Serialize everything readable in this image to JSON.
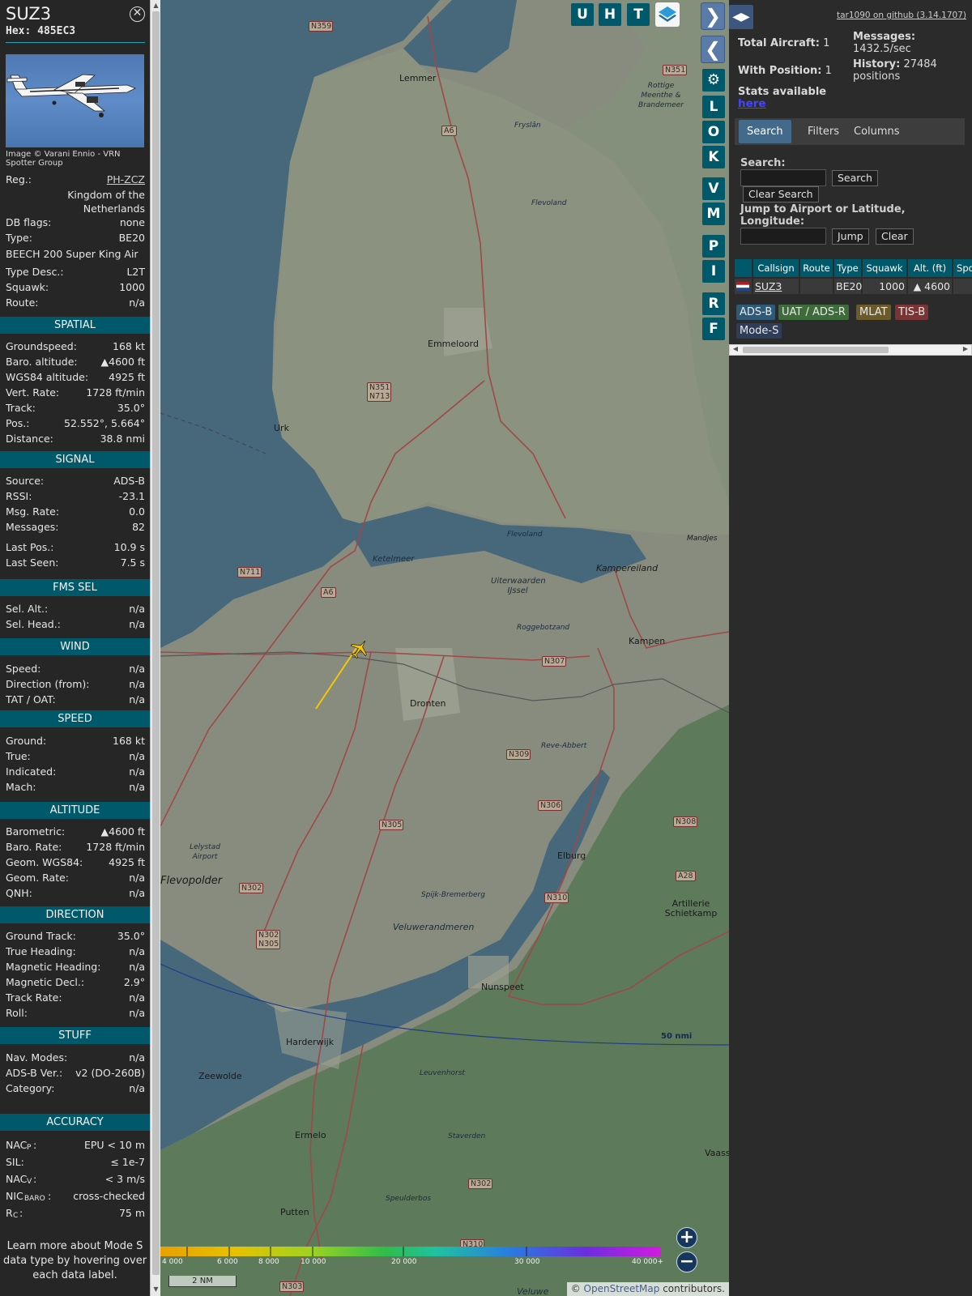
{
  "aircraft": {
    "callsign": "SUZ3",
    "hex_label": "Hex:",
    "hex": "485EC3",
    "photo_credit": "Image © Varani Ennio - VRN Spotter Group",
    "reg_label": "Reg.:",
    "reg": "PH-ZCZ",
    "country": "Kingdom of the Netherlands",
    "rows_top": [
      {
        "k": "DB flags:",
        "v": "none"
      },
      {
        "k": "Type:",
        "v": "BE20"
      }
    ],
    "type_full": "BEECH 200 Super King Air",
    "rows_top2": [
      {
        "k": "Type Desc.:",
        "v": "L2T"
      },
      {
        "k": "Squawk:",
        "v": "1000"
      },
      {
        "k": "Route:",
        "v": "n/a"
      }
    ]
  },
  "sections": {
    "spatial": "SPATIAL",
    "signal": "SIGNAL",
    "fms": "FMS SEL",
    "wind": "WIND",
    "speed": "SPEED",
    "altitude": "ALTITUDE",
    "direction": "DIRECTION",
    "stuff": "STUFF",
    "accuracy": "ACCURACY"
  },
  "spatial": [
    {
      "k": "Groundspeed:",
      "v": "168 kt"
    },
    {
      "k": "Baro. altitude:",
      "v": "▲4600 ft"
    },
    {
      "k": "WGS84 altitude:",
      "v": "4925 ft"
    },
    {
      "k": "Vert. Rate:",
      "v": "1728 ft/min"
    },
    {
      "k": "Track:",
      "v": "35.0°"
    },
    {
      "k": "Pos.:",
      "v": "52.552°, 5.664°"
    },
    {
      "k": "Distance:",
      "v": "38.8 nmi"
    }
  ],
  "signal": [
    {
      "k": "Source:",
      "v": "ADS-B"
    },
    {
      "k": "RSSI:",
      "v": "-23.1"
    },
    {
      "k": "Msg. Rate:",
      "v": "0.0"
    },
    {
      "k": "Messages:",
      "v": "82"
    },
    {
      "k": "Last Pos.:",
      "v": "10.9 s"
    },
    {
      "k": "Last Seen:",
      "v": "7.5 s"
    }
  ],
  "fms": [
    {
      "k": "Sel. Alt.:",
      "v": "n/a"
    },
    {
      "k": "Sel. Head.:",
      "v": "n/a"
    }
  ],
  "wind": [
    {
      "k": "Speed:",
      "v": "n/a"
    },
    {
      "k": "Direction (from):",
      "v": "n/a"
    },
    {
      "k": "TAT / OAT:",
      "v": "n/a"
    }
  ],
  "speed": [
    {
      "k": "Ground:",
      "v": "168 kt"
    },
    {
      "k": "True:",
      "v": "n/a"
    },
    {
      "k": "Indicated:",
      "v": "n/a"
    },
    {
      "k": "Mach:",
      "v": "n/a"
    }
  ],
  "altitude": [
    {
      "k": "Barometric:",
      "v": "▲4600 ft"
    },
    {
      "k": "Baro. Rate:",
      "v": "1728 ft/min"
    },
    {
      "k": "Geom. WGS84:",
      "v": "4925 ft"
    },
    {
      "k": "Geom. Rate:",
      "v": "n/a"
    },
    {
      "k": "QNH:",
      "v": "n/a"
    }
  ],
  "direction": [
    {
      "k": "Ground Track:",
      "v": "35.0°"
    },
    {
      "k": "True Heading:",
      "v": "n/a"
    },
    {
      "k": "Magnetic Heading:",
      "v": "n/a"
    },
    {
      "k": "Magnetic Decl.:",
      "v": "2.9°"
    },
    {
      "k": "Track Rate:",
      "v": "n/a"
    },
    {
      "k": "Roll:",
      "v": "n/a"
    }
  ],
  "stuff": [
    {
      "k": "Nav. Modes:",
      "v": "n/a"
    },
    {
      "k": "ADS-B Ver.:",
      "v": "v2 (DO-260B)"
    },
    {
      "k": "Category:",
      "v": "n/a"
    }
  ],
  "accuracy": [
    {
      "k": "NAC",
      "sub": "P",
      "v": "EPU < 10 m"
    },
    {
      "k": "SIL:",
      "sub": "",
      "v": "≤ 1e-7"
    },
    {
      "k": "NAC",
      "sub": "V",
      "v": "< 3 m/s"
    },
    {
      "k": "NIC",
      "sub": "BARO",
      "v": "cross-checked"
    },
    {
      "k": "R",
      "sub": "C",
      "v": "75 m"
    }
  ],
  "footer_note": [
    "Learn more about Mode S",
    "data type by hovering over",
    "each data label."
  ],
  "map": {
    "top_buttons": [
      "U",
      "H",
      "T"
    ],
    "side_buttons": [
      "L",
      "O",
      "K",
      "V",
      "M",
      "P",
      "I",
      "R",
      "F"
    ],
    "labels": {
      "lemmer": "Lemmer",
      "emmeloord": "Emmeloord",
      "urk": "Urk",
      "ketelmeer": "Ketelmeer",
      "kampereiland": "Kampereiland",
      "uiterwaarden": "Uiterwaarden IJssel",
      "roggebotzand": "Roggebotzand",
      "kampen": "Kampen",
      "dronten": "Dronten",
      "reve_abbert": "Reve-Abbert",
      "elburg": "Elburg",
      "flevopolder": "Flevopolder",
      "lelystad": "Lelystad Airport",
      "spijk": "Spijk-Bremerberg",
      "veluwerandmeren": "Veluwerandmeren",
      "nunspeet": "Nunspeet",
      "harderwijk": "Harderwijk",
      "zeewolde": "Zeewolde",
      "leuvenhorst": "Leuvenhorst",
      "ermelo": "Ermelo",
      "staverden": "Staverden",
      "putten": "Putten",
      "speulderbos": "Speulderbos",
      "artillerie": "Artillerie Schietkamp",
      "rottige": "Rottige Meenthe & Brandemeer",
      "flevoland1": "Flevoland",
      "flevoland2": "Flevoland",
      "mandjes": "Mandjes",
      "vaass": "Vaass",
      "veluwe": "Veluwe",
      "frysland": "Fryslân",
      "range_ring": "50 nmi"
    },
    "roads": [
      "N359",
      "N351",
      "A6",
      "N351 N713",
      "N711",
      "A6",
      "N307",
      "N309",
      "N306",
      "N305",
      "N302",
      "N302 N305",
      "N310",
      "N308",
      "A28",
      "N302",
      "N310",
      "N303"
    ],
    "scale": "2 NM",
    "alt_legend_labels": [
      "4 000",
      "6 000",
      "8 000",
      "10 000",
      "20 000",
      "30 000",
      "40 000+"
    ],
    "attribution_prefix": "© ",
    "attribution_link": "OpenStreetMap",
    "attribution_suffix": " contributors."
  },
  "right": {
    "github": "tar1090 on github (3.14.1707)",
    "total_label": "Total Aircraft:",
    "total": "1",
    "withpos_label": "With Position:",
    "withpos": "1",
    "messages_label": "Messages:",
    "messages": "1432.5/sec",
    "history_label": "History:",
    "history": "27484 positions",
    "stats_label": "Stats available",
    "stats_link": "here",
    "tabs": [
      "Search",
      "Filters",
      "Columns"
    ],
    "search_label": "Search:",
    "search_button": "Search",
    "clear_search_button": "Clear Search",
    "jump_label": "Jump to Airport or Latitude, Longitude:",
    "jump_button": "Jump",
    "clear_button": "Clear",
    "columns": [
      "",
      "Callsign",
      "Route",
      "Type",
      "Squawk",
      "Alt. (ft)",
      "Spd"
    ],
    "row": {
      "callsign": "SUZ3",
      "route": "",
      "type": "BE20",
      "squawk": "1000",
      "alt": "▲ 4600"
    },
    "source_chips": [
      {
        "label": "ADS-B",
        "color": "#2e5a78"
      },
      {
        "label": "UAT / ADS-R",
        "color": "#3e6b3a"
      },
      {
        "label": "MLAT",
        "color": "#6b5a2a"
      },
      {
        "label": "TIS-B",
        "color": "#7a3434"
      },
      {
        "label": "Mode-S",
        "color": "#2d3d5a"
      }
    ]
  }
}
